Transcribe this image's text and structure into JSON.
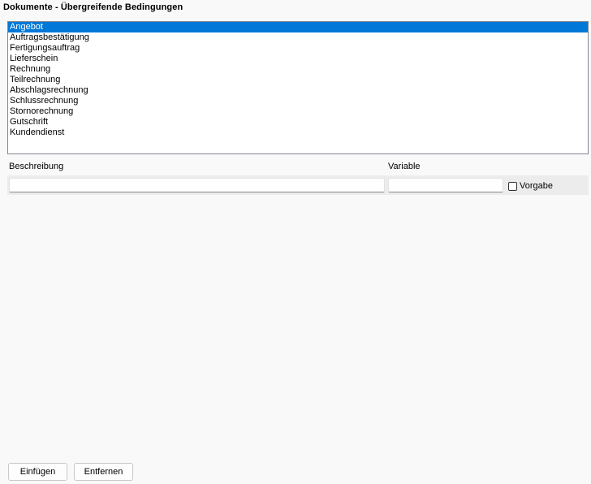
{
  "page": {
    "title": "Dokumente - Übergreifende Bedingungen"
  },
  "documents_list": {
    "items": [
      {
        "label": "Angebot",
        "selected": true
      },
      {
        "label": "Auftragsbestätigung",
        "selected": false
      },
      {
        "label": "Fertigungsauftrag",
        "selected": false
      },
      {
        "label": "Lieferschein",
        "selected": false
      },
      {
        "label": "Rechnung",
        "selected": false
      },
      {
        "label": "Teilrechnung",
        "selected": false
      },
      {
        "label": "Abschlagsrechnung",
        "selected": false
      },
      {
        "label": "Schlussrechnung",
        "selected": false
      },
      {
        "label": "Stornorechnung",
        "selected": false
      },
      {
        "label": "Gutschrift",
        "selected": false
      },
      {
        "label": "Kundendienst",
        "selected": false
      }
    ],
    "selection_color": "#0078d7"
  },
  "form": {
    "beschreibung_label": "Beschreibung",
    "beschreibung_value": "",
    "variable_label": "Variable",
    "variable_value": "",
    "vorgabe_label": "Vorgabe",
    "vorgabe_checked": false
  },
  "footer": {
    "einfuegen_label": "Einfügen",
    "entfernen_label": "Entfernen"
  }
}
